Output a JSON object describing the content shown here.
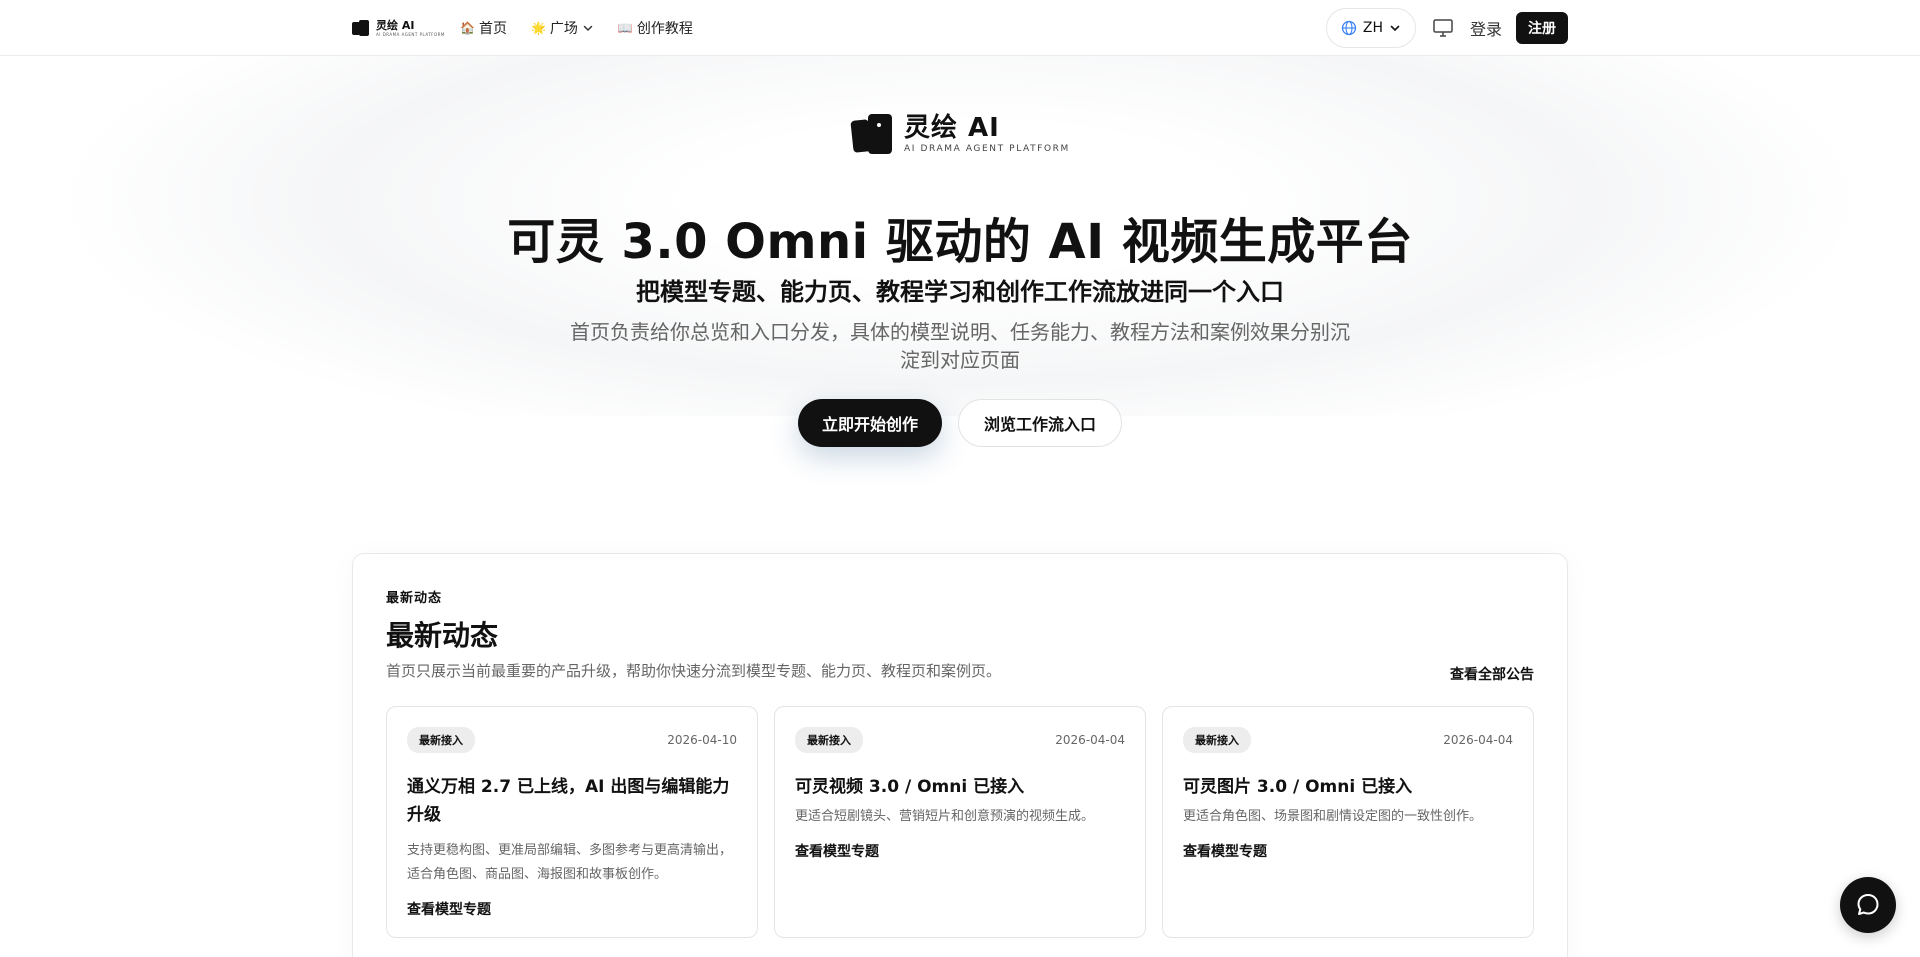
{
  "nav": {
    "brand_name": "灵绘 AI",
    "brand_sub": "AI DRAMA AGENT PLATFORM",
    "links": [
      {
        "emoji": "🏠",
        "label": "首页"
      },
      {
        "emoji": "🌟",
        "label": "广场"
      },
      {
        "emoji": "📖",
        "label": "创作教程"
      }
    ],
    "lang": "ZH",
    "login": "登录",
    "register": "注册"
  },
  "hero": {
    "logo_name": "灵绘 AI",
    "logo_sub": "AI DRAMA AGENT PLATFORM",
    "title": "可灵 3.0 Omni 驱动的 AI 视频生成平台",
    "subtitle": "把模型专题、能力页、教程学习和创作工作流放进同一个入口",
    "desc": "首页负责给你总览和入口分发，具体的模型说明、任务能力、教程方法和案例效果分别沉淀到对应页面",
    "primary_btn": "立即开始创作",
    "secondary_btn": "浏览工作流入口"
  },
  "news": {
    "kicker": "最新动态",
    "title": "最新动态",
    "desc": "首页只展示当前最重要的产品升级，帮助你快速分流到模型专题、能力页、教程页和案例页。",
    "view_all": "查看全部公告",
    "cards": [
      {
        "badge": "最新接入",
        "date": "2026-04-10",
        "title": "通义万相 2.7 已上线，AI 出图与编辑能力升级",
        "desc": "支持更稳构图、更准局部编辑、多图参考与更高清输出，适合角色图、商品图、海报图和故事板创作。",
        "link": "查看模型专题"
      },
      {
        "badge": "最新接入",
        "date": "2026-04-04",
        "title": "可灵视频 3.0 / Omni 已接入",
        "desc": "更适合短剧镜头、营销短片和创意预演的视频生成。",
        "link": "查看模型专题"
      },
      {
        "badge": "最新接入",
        "date": "2026-04-04",
        "title": "可灵图片 3.0 / Omni 已接入",
        "desc": "更适合角色图、场景图和剧情设定图的一致性创作。",
        "link": "查看模型专题"
      }
    ]
  }
}
